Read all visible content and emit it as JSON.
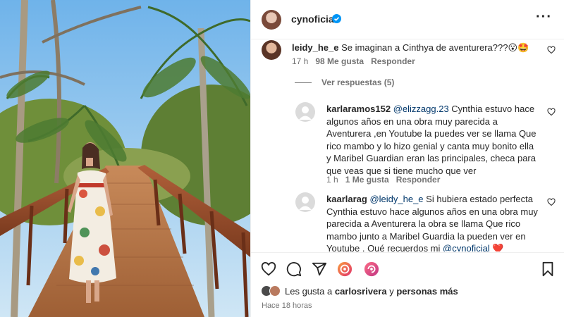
{
  "post": {
    "username": "cynoficial",
    "more_icon": "more-horizontal-icon",
    "time_ago": "Hace 18 horas"
  },
  "comments": [
    {
      "user": "leidy_he_e",
      "text": "Se imaginan a Cinthya de aventurera???😮🤩",
      "time": "17 h",
      "likes": "98 Me gusta",
      "reply": "Responder",
      "view_replies": "Ver respuestas (5)"
    },
    {
      "user": "karlaramos152",
      "mention": "@elizzagg.23",
      "text": "Cynthia estuvo hace algunos años en una obra muy parecida a Aventurera ,en Youtube la puedes ver se llama Que rico mambo y lo hizo genial y canta muy bonito ella y Maribel Guardian eran las principales, checa para que veas que si tiene mucho que ver",
      "time": "1 h",
      "likes": "1 Me gusta",
      "reply": "Responder"
    },
    {
      "user": "kaarlarag",
      "mention": "@leidy_he_e",
      "text": "Si hubiera estado perfecta Cynthia estuvo hace algunos años en una obra muy parecida a Aventurera la obra se llama Que rico mambo junto a Maribel Guardia la pueden ver en Youtube . Qué recuerdos mi",
      "end_mention": "@cynoficial",
      "end_emoji": "❤️"
    }
  ],
  "likes_line": {
    "prefix": "Les gusta a",
    "user": "carlosrivera",
    "conj": "y",
    "others": "personas más"
  },
  "colors": {
    "mention": "#00376b",
    "secondary": "#737373",
    "verified": "#0095f6",
    "heart": "#ed4956"
  }
}
